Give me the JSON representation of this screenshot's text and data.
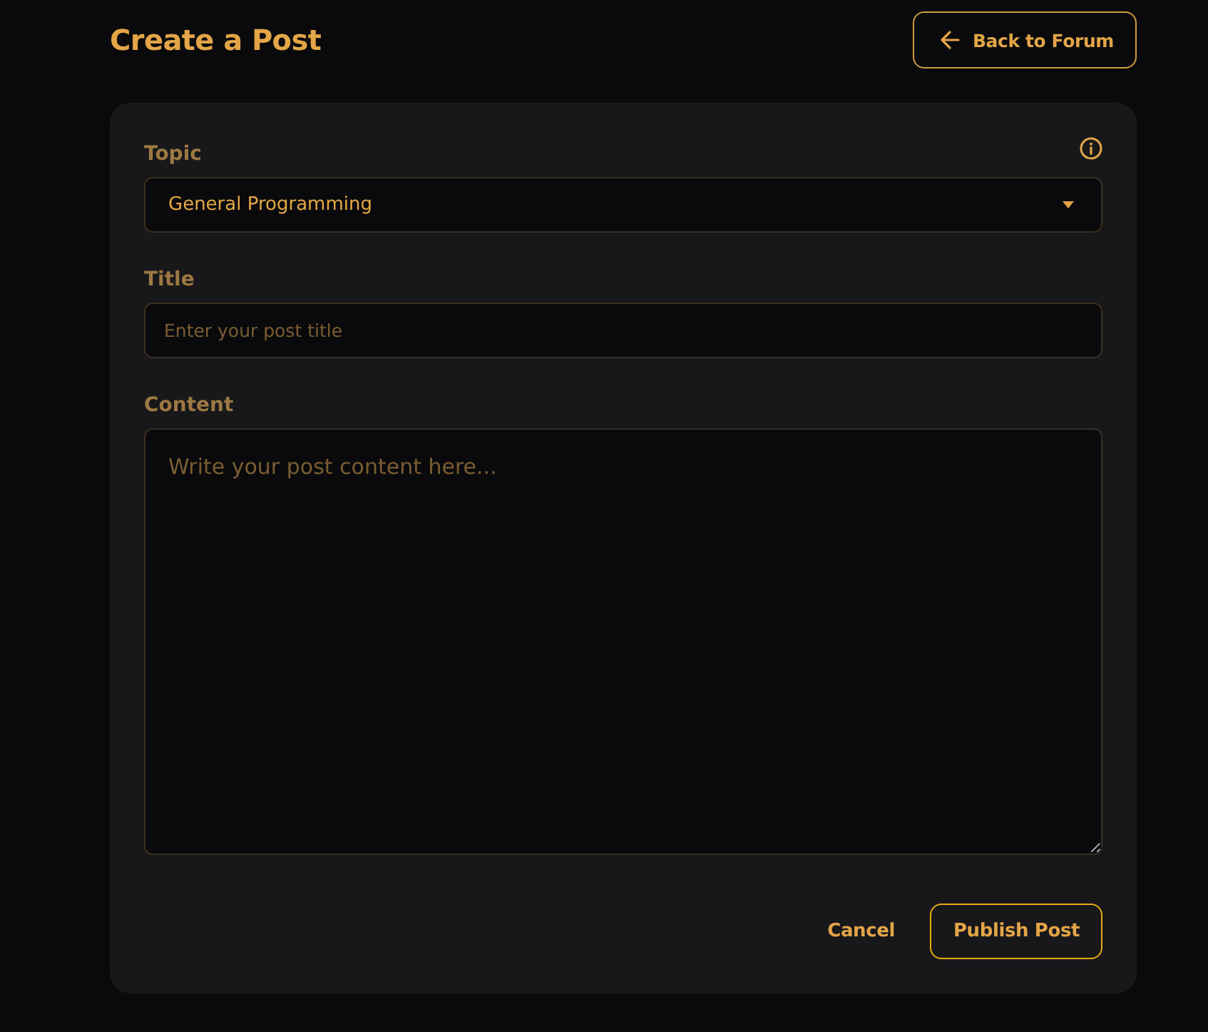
{
  "header": {
    "title": "Create a Post",
    "back_button": {
      "label": "Back to Forum"
    }
  },
  "form": {
    "fields": [
      {
        "kind": "select",
        "label": "Topic",
        "value": "General Programming"
      },
      {
        "kind": "input",
        "label": "Title",
        "placeholder": "Enter your post title"
      },
      {
        "kind": "textarea",
        "label": "Content",
        "placeholder": "Write your post content here..."
      }
    ],
    "actions": [
      {
        "kind": "text",
        "label": "Cancel"
      },
      {
        "kind": "outlined",
        "label": "Publish Post"
      }
    ]
  }
}
